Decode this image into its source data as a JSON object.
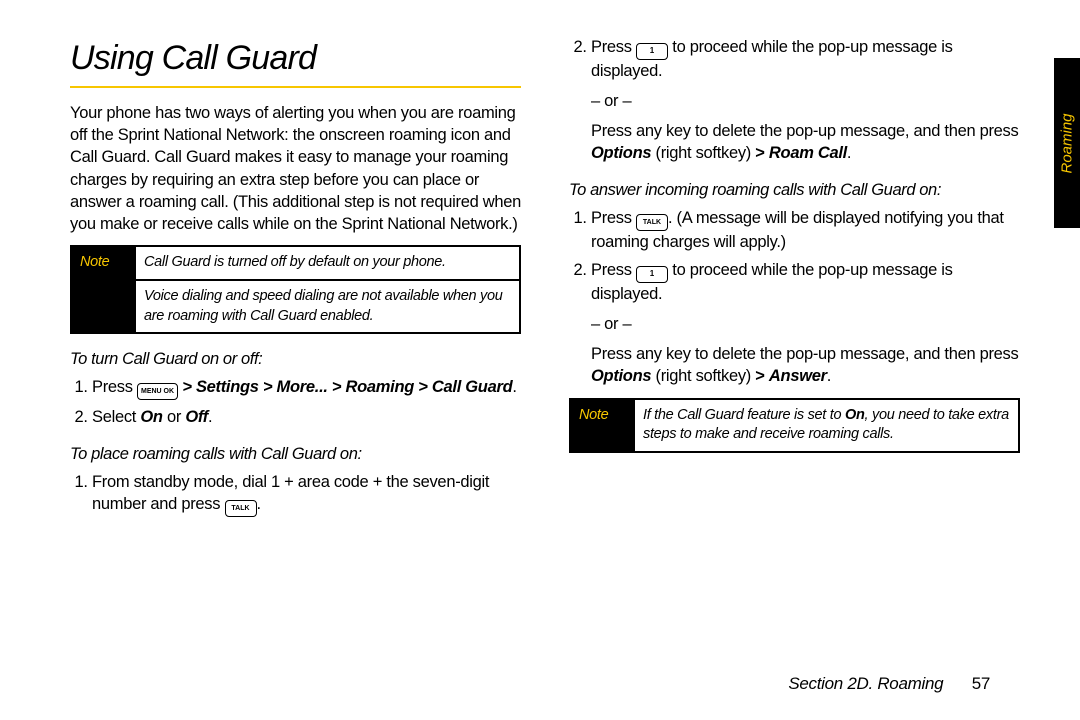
{
  "title": "Using Call Guard",
  "intro": "Your phone has two ways of alerting you when you are roaming off the Sprint National Network: the onscreen roaming icon and Call Guard. Call Guard makes it easy to manage your roaming charges by requiring an extra step before you can place or answer a roaming call. (This additional step is not required when you make or receive calls while on the Sprint National Network.)",
  "note1": {
    "label": "Note",
    "line1": "Call Guard is turned off by default on your phone.",
    "line2": "Voice dialing and speed dialing are not available when you are roaming with Call Guard enabled."
  },
  "sub_turn": "To turn Call Guard on or off:",
  "turn": {
    "press": "Press",
    "menu_key": "MENU OK",
    "path1": "> Settings > More... > Roaming > Call Guard",
    "period": ".",
    "select": "Select",
    "on": "On",
    "or_word": "or",
    "off": "Off"
  },
  "sub_place": "To place roaming calls with Call Guard on:",
  "place": {
    "l1a": "From standby mode, dial 1 + area code + the seven-digit number and press",
    "talk_key": "TALK",
    "period": "."
  },
  "right": {
    "l2_press": "Press",
    "one_key": "1",
    "l2_rest": "to proceed while the pop-up message is displayed.",
    "or": "– or –",
    "l2b_a": "Press any key to delete the pop-up message, and then press",
    "options": "Options",
    "softkey": "(right softkey)",
    "gt": ">",
    "roamcall": "Roam Call",
    "period": "."
  },
  "sub_answer": "To answer incoming roaming calls with Call Guard on:",
  "answer": {
    "l1_press": "Press",
    "talk_key": "TALK",
    "l1_rest": ". (A message will be displayed notifying you that roaming charges will apply.)",
    "l2_press": "Press",
    "one_key": "1",
    "l2_rest": "to proceed while the pop-up message is displayed.",
    "or": "– or –",
    "l2b_a": "Press any key to delete the pop-up message, and then press",
    "options": "Options",
    "softkey": "(right softkey)",
    "gt": ">",
    "answer_word": "Answer",
    "period": "."
  },
  "note2": {
    "label": "Note",
    "text_a": "If the Call Guard feature is set to",
    "on": "On",
    "text_b": ", you need to take extra steps to make and receive roaming calls."
  },
  "side_tab": "Roaming",
  "footer_section": "Section 2D. Roaming",
  "footer_page": "57"
}
